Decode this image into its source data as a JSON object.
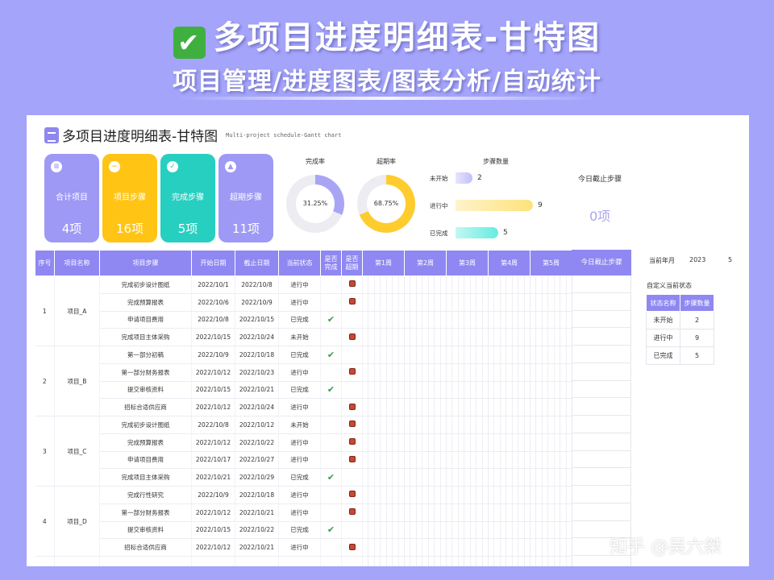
{
  "banner": {
    "check_glyph": "✔",
    "title": "多项目进度明细表-甘特图",
    "subtitle": "项目管理/进度图表/图表分析/自动统计"
  },
  "sheet": {
    "title": "多项目进度明细表-甘特图",
    "subtitle": "Multi-project schedule-Gantt chart"
  },
  "cards": [
    {
      "label": "合计项目",
      "value": "4项",
      "color": "#9e99f5",
      "icon": "document-icon",
      "glyph": "≡"
    },
    {
      "label": "项目步骤",
      "value": "16项",
      "color": "#ffc414",
      "icon": "minus-icon",
      "glyph": "−"
    },
    {
      "label": "完成步骤",
      "value": "5项",
      "color": "#27cfc0",
      "icon": "check-icon",
      "glyph": "✓"
    },
    {
      "label": "超期步骤",
      "value": "11项",
      "color": "#9e99f5",
      "icon": "warning-icon",
      "glyph": "▲"
    }
  ],
  "kpis": {
    "completion_label": "完成率",
    "completion_value": "31.25%",
    "completion_fraction": 0.3125,
    "overdue_label": "超期率",
    "overdue_value": "68.75%",
    "overdue_fraction": 0.6875,
    "steps_label": "步骤数量",
    "today_label": "今日截止步骤",
    "today_value": "0项"
  },
  "step_stats": [
    {
      "name": "未开始",
      "count": "2",
      "color": "#c2bff9"
    },
    {
      "name": "进行中",
      "count": "9",
      "color": "#fde27c"
    },
    {
      "name": "已完成",
      "count": "5",
      "color": "#66ece0"
    }
  ],
  "table": {
    "headers": {
      "seq": "序号",
      "project": "项目名称",
      "step": "项目步骤",
      "start": "开始日期",
      "end": "截止日期",
      "status": "当前状态",
      "done": "是否完成",
      "overdue": "是否超期"
    },
    "weeks": [
      "第1周",
      "第2周",
      "第3周",
      "第4周",
      "第5周"
    ],
    "projects": [
      {
        "seq": "1",
        "name": "项目_A",
        "steps": [
          {
            "step": "完成初步设计图纸",
            "start": "2022/10/1",
            "end": "2022/10/8",
            "status": "进行中",
            "done": false,
            "overdue": true
          },
          {
            "step": "完成预算报表",
            "start": "2022/10/6",
            "end": "2022/10/9",
            "status": "进行中",
            "done": false,
            "overdue": true
          },
          {
            "step": "申请项目费用",
            "start": "2022/10/8",
            "end": "2022/10/15",
            "status": "已完成",
            "done": true,
            "overdue": false
          },
          {
            "step": "完成项目主体采购",
            "start": "2022/10/15",
            "end": "2022/10/24",
            "status": "未开始",
            "done": false,
            "overdue": true
          }
        ]
      },
      {
        "seq": "2",
        "name": "项目_B",
        "steps": [
          {
            "step": "第一部分初稿",
            "start": "2022/10/9",
            "end": "2022/10/18",
            "status": "已完成",
            "done": true,
            "overdue": false
          },
          {
            "step": "第一部分财务报表",
            "start": "2022/10/12",
            "end": "2022/10/23",
            "status": "进行中",
            "done": false,
            "overdue": true
          },
          {
            "step": "提交审核资料",
            "start": "2022/10/15",
            "end": "2022/10/21",
            "status": "已完成",
            "done": true,
            "overdue": false
          },
          {
            "step": "招标合适供应商",
            "start": "2022/10/12",
            "end": "2022/10/24",
            "status": "进行中",
            "done": false,
            "overdue": true
          }
        ]
      },
      {
        "seq": "3",
        "name": "项目_C",
        "steps": [
          {
            "step": "完成初步设计图纸",
            "start": "2022/10/8",
            "end": "2022/10/12",
            "status": "未开始",
            "done": false,
            "overdue": true
          },
          {
            "step": "完成预算报表",
            "start": "2022/10/12",
            "end": "2022/10/22",
            "status": "进行中",
            "done": false,
            "overdue": true
          },
          {
            "step": "申请项目费用",
            "start": "2022/10/17",
            "end": "2022/10/27",
            "status": "进行中",
            "done": false,
            "overdue": true
          },
          {
            "step": "完成项目主体采购",
            "start": "2022/10/21",
            "end": "2022/10/29",
            "status": "已完成",
            "done": true,
            "overdue": false
          }
        ]
      },
      {
        "seq": "4",
        "name": "项目_D",
        "steps": [
          {
            "step": "完成行性研究",
            "start": "2022/10/9",
            "end": "2022/10/18",
            "status": "进行中",
            "done": false,
            "overdue": true
          },
          {
            "step": "第一部分财务报表",
            "start": "2022/10/12",
            "end": "2022/10/21",
            "status": "进行中",
            "done": false,
            "overdue": true
          },
          {
            "step": "提交审核资料",
            "start": "2022/10/15",
            "end": "2022/10/22",
            "status": "已完成",
            "done": true,
            "overdue": false
          },
          {
            "step": "招标合适供应商",
            "start": "2022/10/12",
            "end": "2022/10/21",
            "status": "进行中",
            "done": false,
            "overdue": true
          }
        ]
      }
    ]
  },
  "side": {
    "today_header": "今日截止步骤",
    "month_label": "当前年月",
    "year": "2023",
    "month": "5",
    "status_title": "自定义当前状态",
    "status_headers": [
      "状态名称",
      "步骤数量"
    ],
    "status_rows": [
      {
        "name": "未开始",
        "count": "2"
      },
      {
        "name": "进行中",
        "count": "9"
      },
      {
        "name": "已完成",
        "count": "5"
      }
    ]
  },
  "watermark": "知乎 @吴六桀"
}
